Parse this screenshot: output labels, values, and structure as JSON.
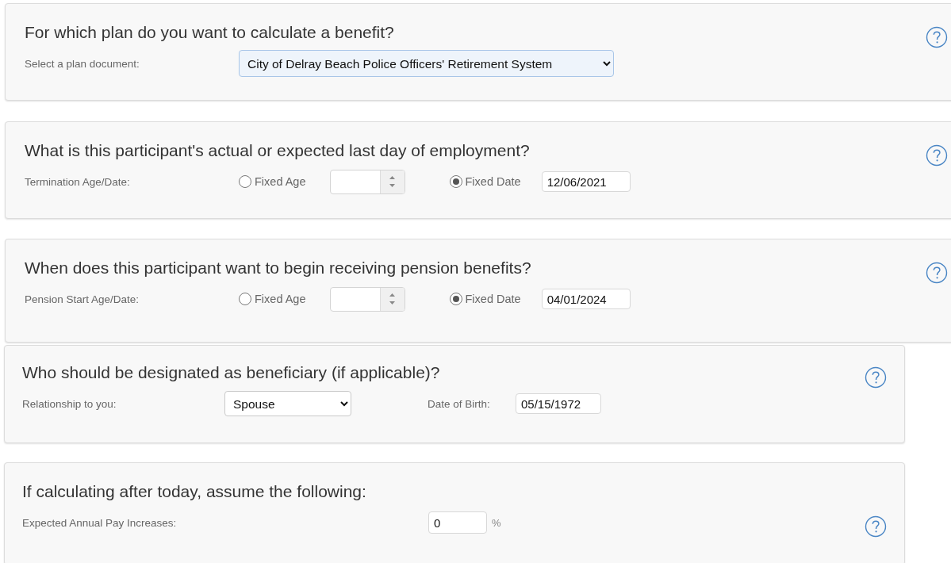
{
  "sections": [
    {
      "kind": "plan",
      "title": "For which plan do you want to calculate a benefit?",
      "label": "Select a plan document:",
      "select_value": "City of Delray Beach Police Officers' Retirement System"
    },
    {
      "kind": "age_date",
      "title": "What is this participant's actual or expected last day of employment?",
      "label": "Termination Age/Date:",
      "options": [
        {
          "label": "Fixed Age",
          "selected": false
        },
        {
          "label": "Fixed Date",
          "selected": true
        }
      ],
      "date": "12/06/2021"
    },
    {
      "kind": "age_date",
      "title": "When does this participant want to begin receiving pension benefits?",
      "label": "Pension Start Age/Date:",
      "options": [
        {
          "label": "Fixed Age",
          "selected": false
        },
        {
          "label": "Fixed Date",
          "selected": true
        }
      ],
      "date": "04/01/2024"
    },
    {
      "kind": "beneficiary",
      "title": "Who should be designated as beneficiary (if applicable)?",
      "label": "Relationship to you:",
      "select_value": "Spouse",
      "dob_label": "Date of Birth:",
      "dob": "05/15/1972"
    },
    {
      "kind": "assumption",
      "title": "If calculating after today, assume the following:",
      "label": "Expected Annual Pay Increases:",
      "value": "0",
      "unit": "%"
    }
  ]
}
